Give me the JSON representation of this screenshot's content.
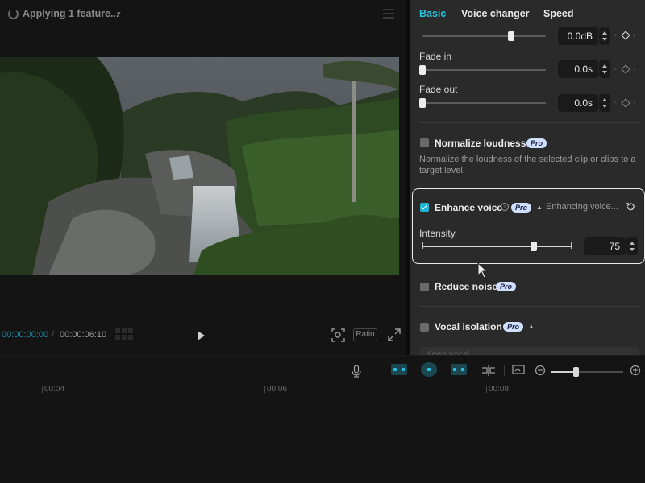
{
  "player": {
    "status_title": "Applying 1 feature...",
    "timecode_current": "00:00:00:00",
    "timecode_separator": "/",
    "timecode_total": "00:00:06:10",
    "ratio_label": "Ratio",
    "icons": [
      "loading-spinner-icon",
      "chevron-down-icon",
      "menu-icon",
      "play-icon",
      "fit-view-icon",
      "fullscreen-icon",
      "grid-icon"
    ]
  },
  "tabs": [
    {
      "label": "Basic",
      "active": true
    },
    {
      "label": "Voice changer",
      "active": false
    },
    {
      "label": "Speed",
      "active": false
    }
  ],
  "volume": {
    "value": "0.0dB",
    "level_fraction": 0.72
  },
  "fade_in": {
    "label": "Fade in",
    "value": "0.0s"
  },
  "fade_out": {
    "label": "Fade out",
    "value": "0.0s"
  },
  "normalize": {
    "title": "Normalize loudness",
    "badge": "Pro",
    "checked": false,
    "description_line1": "Normalize the loudness of the selected clip or clips to a",
    "description_line2": "target level."
  },
  "enhance": {
    "title": "Enhance voice",
    "badge": "Pro",
    "checked": true,
    "status": "Enhancing voice...",
    "intensity_label": "Intensity",
    "intensity_value": "75",
    "intensity_fraction": 0.75
  },
  "reduce_noise": {
    "title": "Reduce noise",
    "badge": "Pro",
    "checked": false
  },
  "vocal_isolation": {
    "title": "Vocal isolation",
    "badge": "Pro",
    "checked": false,
    "option": "Keep vocal"
  },
  "timeline": {
    "ruler": [
      "00:04",
      "00:06",
      "00:08"
    ],
    "zoom_fraction": 0.32,
    "icons": [
      "microphone-icon",
      "link-clips-icon",
      "magnetic-icon",
      "split-icon",
      "align-icon",
      "preview-icon",
      "zoom-out-icon",
      "zoom-in-icon"
    ]
  },
  "colors": {
    "accent": "#27c4e0",
    "checkbox_on": "#1eb6d4",
    "pro_badge": "#cfe0ff"
  }
}
